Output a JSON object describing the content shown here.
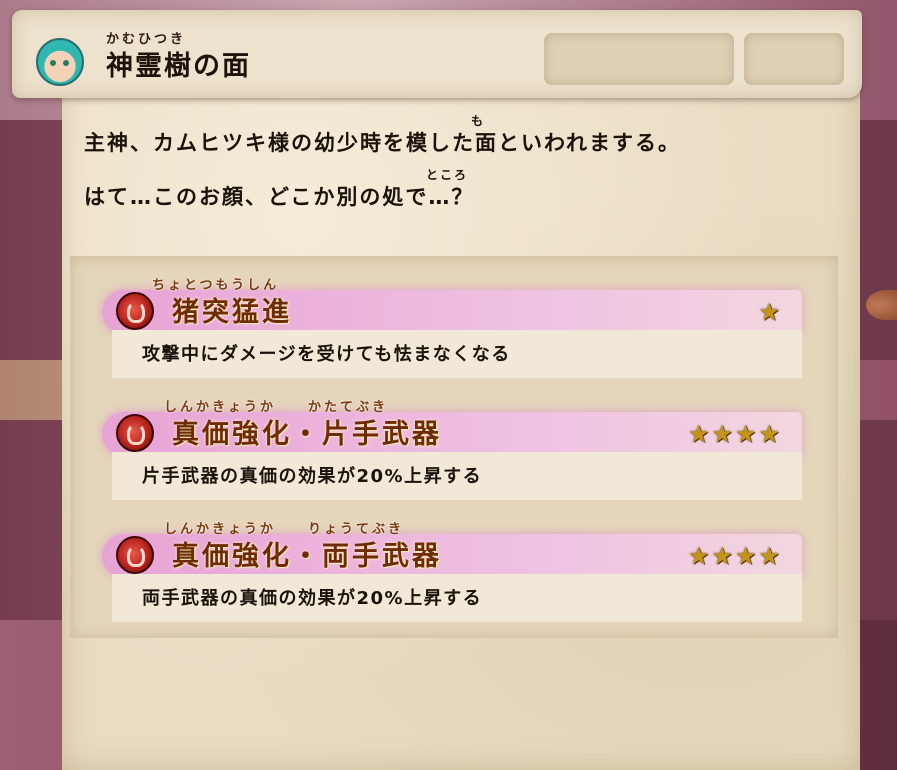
{
  "header": {
    "title_ruby": "かむひつき",
    "title": "神霊樹の面"
  },
  "description": {
    "line1": "主神、カムヒツキ様の幼少時を模した面といわれまする。",
    "line1_ruby": "も",
    "line2": "はて…このお顔、どこか別の処で…？",
    "line2_ruby": "ところ"
  },
  "skills": [
    {
      "ruby": "ちょとつもうしん",
      "name": "猪突猛進",
      "stars": "★",
      "star_count": 1,
      "description": "攻撃中にダメージを受けても怯まなくなる",
      "icon": "skill-emblem-icon"
    },
    {
      "ruby": "しんかきょうか　　かたてぶき",
      "name": "真価強化・片手武器",
      "stars": "★★★★",
      "star_count": 4,
      "description": "片手武器の真価の効果が20%上昇する",
      "icon": "skill-emblem-icon"
    },
    {
      "ruby": "しんかきょうか　　りょうてぶき",
      "name": "真価強化・両手武器",
      "stars": "★★★★",
      "star_count": 4,
      "description": "両手武器の真価の効果が20%上昇する",
      "icon": "skill-emblem-icon"
    }
  ],
  "colors": {
    "panel": "#e9dcc3",
    "skill_bar": "#e8a0d6",
    "skill_name": "#6e2c05",
    "star": "#c49418"
  }
}
